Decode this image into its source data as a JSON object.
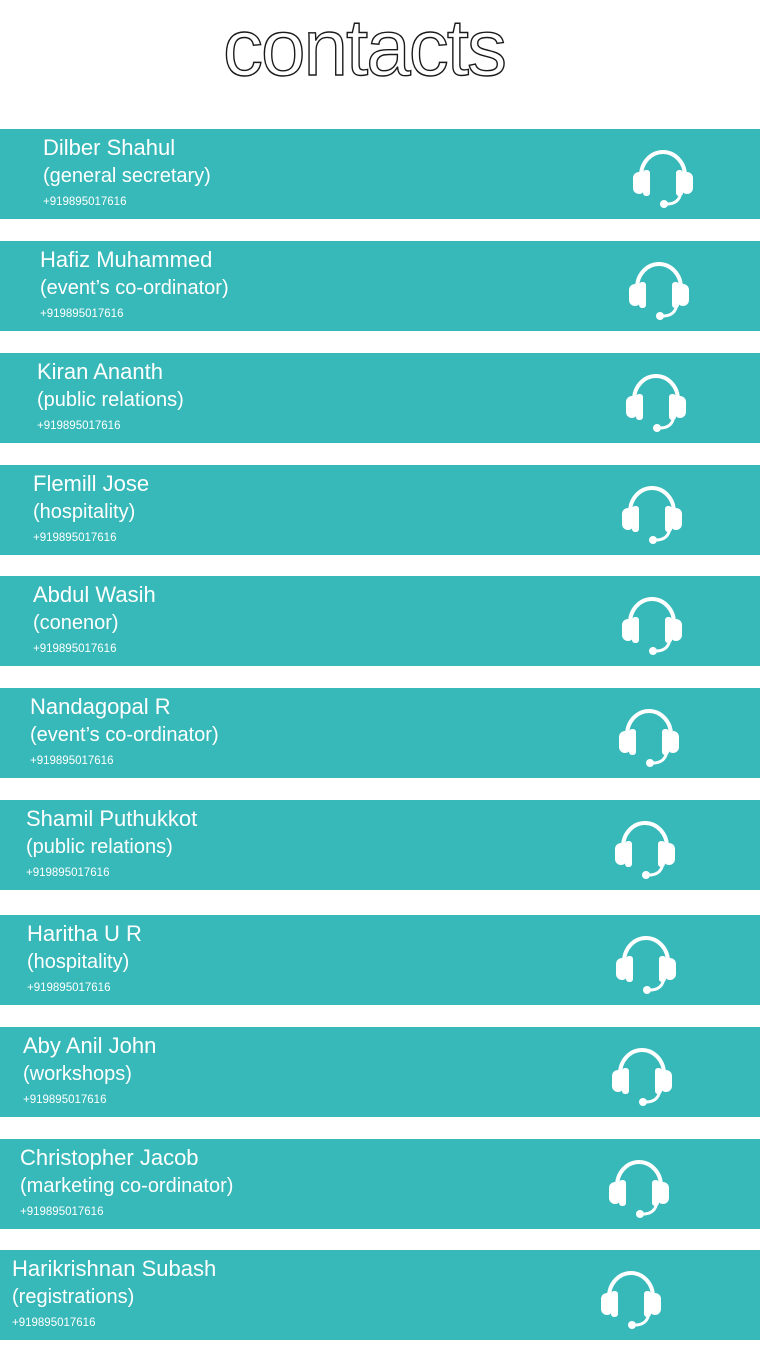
{
  "page": {
    "title": "contacts"
  },
  "colors": {
    "row_background": "#37b8b9",
    "row_text": "#ffffff",
    "title_text": "#1a1a1a",
    "background": "#ffffff"
  },
  "contacts": [
    {
      "name": "Dilber Shahul",
      "role": "(general secretary)",
      "phone": "+919895017616",
      "icon": "headset-icon"
    },
    {
      "name": "Hafiz Muhammed",
      "role": "(event’s co-ordinator)",
      "phone": "+919895017616",
      "icon": "headset-icon"
    },
    {
      "name": "Kiran Ananth",
      "role": "(public relations)",
      "phone": "+919895017616",
      "icon": "headset-icon"
    },
    {
      "name": "Flemill Jose",
      "role": "(hospitality)",
      "phone": "+919895017616",
      "icon": "headset-icon"
    },
    {
      "name": "Abdul Wasih",
      "role": "(conenor)",
      "phone": "+919895017616",
      "icon": "headset-icon"
    },
    {
      "name": "Nandagopal R",
      "role": "(event’s co-ordinator)",
      "phone": "+919895017616",
      "icon": "headset-icon"
    },
    {
      "name": "Shamil Puthukkot",
      "role": "(public relations)",
      "phone": "+919895017616",
      "icon": "headset-icon"
    },
    {
      "name": "Haritha U R",
      "role": "(hospitality)",
      "phone": "+919895017616",
      "icon": "headset-icon"
    },
    {
      "name": "Aby Anil John",
      "role": "(workshops)",
      "phone": "+919895017616",
      "icon": "headset-icon"
    },
    {
      "name": "Christopher Jacob",
      "role": "(marketing co-ordinator)",
      "phone": "+919895017616",
      "icon": "headset-icon"
    },
    {
      "name": "Harikrishnan Subash",
      "role": "(registrations)",
      "phone": "+919895017616",
      "icon": "headset-icon"
    }
  ]
}
